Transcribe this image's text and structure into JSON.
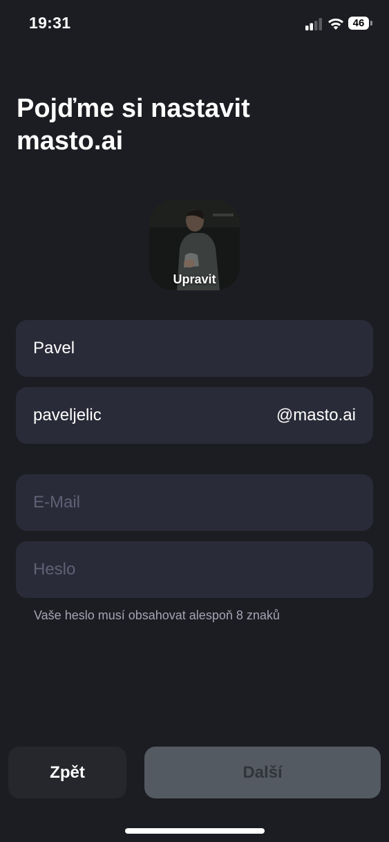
{
  "status_bar": {
    "time": "19:31",
    "battery_level": "46",
    "icons": [
      "cellular-signal-icon",
      "wifi-icon",
      "battery-icon"
    ]
  },
  "title": "Pojďme si nastavit masto.ai",
  "avatar": {
    "edit_label": "Upravit"
  },
  "form": {
    "display_name": {
      "value": "Pavel",
      "placeholder": ""
    },
    "username": {
      "value": "paveljelic",
      "suffix": "@masto.ai"
    },
    "email": {
      "value": "",
      "placeholder": "E-Mail"
    },
    "password": {
      "value": "",
      "placeholder": "Heslo"
    },
    "password_hint": "Vaše heslo musí obsahovat alespoň 8 znaků"
  },
  "buttons": {
    "back_label": "Zpět",
    "next_label": "Další"
  },
  "colors": {
    "background": "#1c1d22",
    "field_background": "#2a2b38",
    "next_button_disabled": "#535a62",
    "placeholder": "#5f6175"
  }
}
